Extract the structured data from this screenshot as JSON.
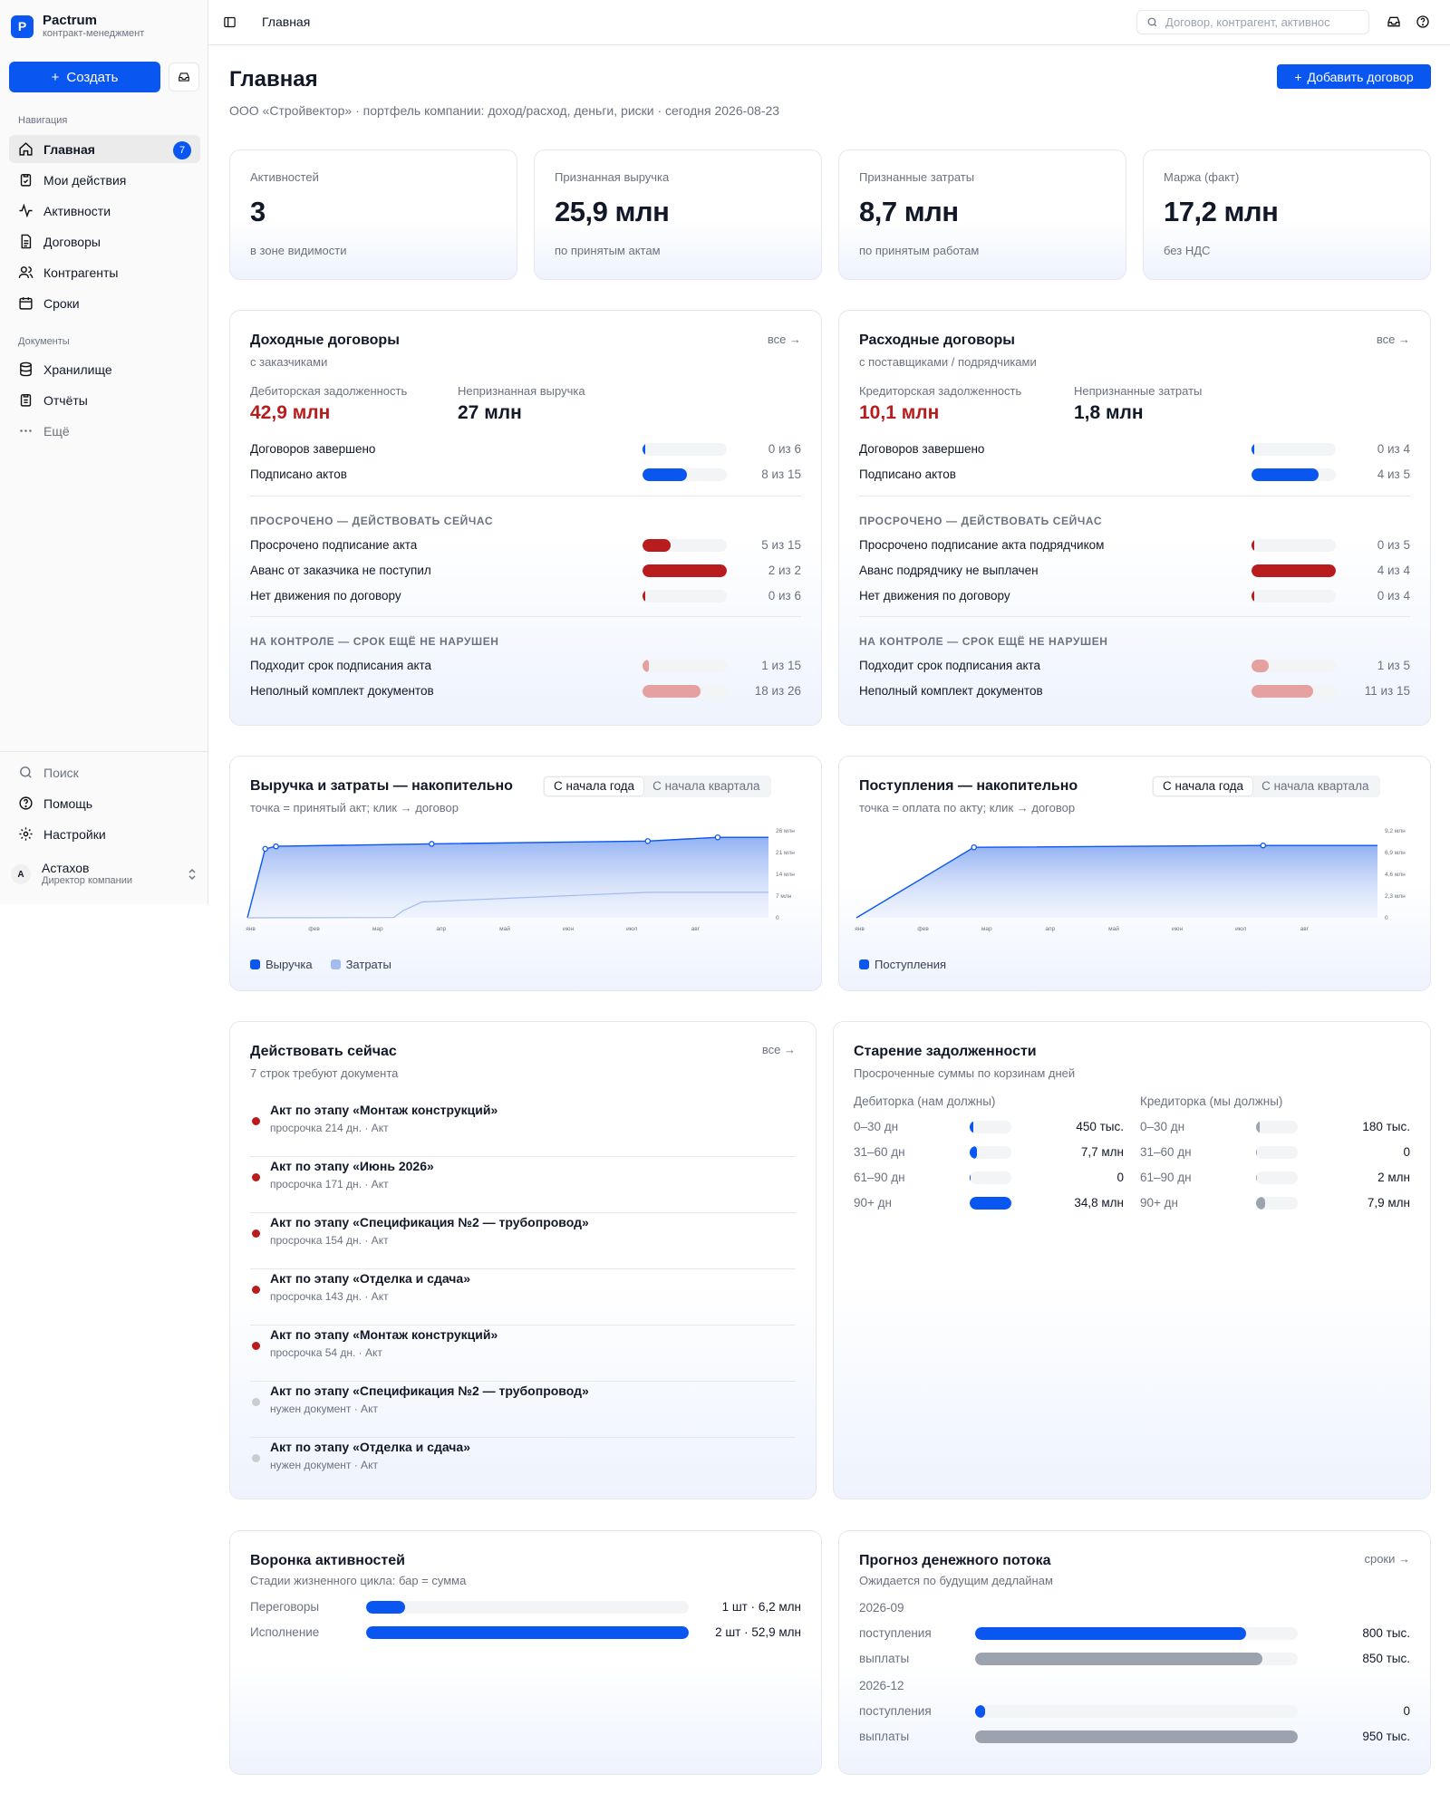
{
  "app": {
    "name": "Pactrum",
    "subtitle": "контракт-менеджмент",
    "logo_letter": "P"
  },
  "sidebar": {
    "create_label": "Создать",
    "nav_heading": "Навигация",
    "nav": [
      {
        "label": "Главная",
        "icon": "home-icon",
        "badge": "7",
        "active": true
      },
      {
        "label": "Мои действия",
        "icon": "clipboard-check-icon"
      },
      {
        "label": "Активности",
        "icon": "activity-icon"
      },
      {
        "label": "Договоры",
        "icon": "document-icon"
      },
      {
        "label": "Контрагенты",
        "icon": "users-icon"
      },
      {
        "label": "Сроки",
        "icon": "calendar-icon"
      }
    ],
    "docs_heading": "Документы",
    "docs": [
      {
        "label": "Хранилище",
        "icon": "database-icon"
      },
      {
        "label": "Отчёты",
        "icon": "report-icon"
      },
      {
        "label": "Ещё",
        "icon": "more-icon"
      }
    ],
    "footer": [
      {
        "label": "Поиск",
        "icon": "search-icon"
      },
      {
        "label": "Помощь",
        "icon": "help-icon"
      },
      {
        "label": "Настройки",
        "icon": "settings-icon"
      }
    ],
    "user": {
      "initial": "A",
      "name": "Астахов",
      "role": "Директор компании"
    }
  },
  "topbar": {
    "breadcrumb": "Главная",
    "search_placeholder": "Договор, контрагент, активнос"
  },
  "header": {
    "title": "Главная",
    "subtitle": "ООО «Стройвектор» · портфель компании: доход/расход, деньги, риски · сегодня 2026-08-23",
    "add_button": "Добавить договор"
  },
  "kpis": [
    {
      "label": "Активностей",
      "value": "3",
      "note": "в зоне видимости"
    },
    {
      "label": "Признанная выручка",
      "value": "25,9 млн",
      "note": "по принятым актам"
    },
    {
      "label": "Признанные затраты",
      "value": "8,7 млн",
      "note": "по принятым работам"
    },
    {
      "label": "Маржа (факт)",
      "value": "17,2 млн",
      "note": "без НДС"
    }
  ],
  "income": {
    "title": "Доходные договоры",
    "subtitle": "с заказчиками",
    "link": "все →",
    "m1_label": "Дебиторская задолженность",
    "m1_value": "42,9 млн",
    "m2_label": "Непризнанная выручка",
    "m2_value": "27 млн",
    "rows": [
      {
        "label": "Договоров завершено",
        "count": "0 из 6",
        "fraction": 0.0,
        "color": "#0a56f0"
      },
      {
        "label": "Подписано актов",
        "count": "8 из 15",
        "fraction": 0.53,
        "color": "#0a56f0"
      }
    ],
    "overdue_heading": "ПРОСРОЧЕНО — ДЕЙСТВОВАТЬ СЕЙЧАС",
    "overdue": [
      {
        "label": "Просрочено подписание акта",
        "count": "5 из 15",
        "fraction": 0.33,
        "color": "#b91c1c"
      },
      {
        "label": "Аванс от заказчика не поступил",
        "count": "2 из 2",
        "fraction": 1.0,
        "color": "#b91c1c"
      },
      {
        "label": "Нет движения по договору",
        "count": "0 из 6",
        "fraction": 0.0,
        "color": "#b91c1c"
      }
    ],
    "control_heading": "НА КОНТРОЛЕ — СРОК ЕЩЁ НЕ НАРУШЕН",
    "control": [
      {
        "label": "Подходит срок подписания акта",
        "count": "1 из 15",
        "fraction": 0.07,
        "color": "#e5a0a0"
      },
      {
        "label": "Неполный комплект документов",
        "count": "18 из 26",
        "fraction": 0.69,
        "color": "#e5a0a0"
      }
    ]
  },
  "expense": {
    "title": "Расходные договоры",
    "subtitle": "с поставщиками / подрядчиками",
    "link": "все →",
    "m1_label": "Кредиторская задолженность",
    "m1_value": "10,1 млн",
    "m2_label": "Непризнанные затраты",
    "m2_value": "1,8 млн",
    "rows": [
      {
        "label": "Договоров завершено",
        "count": "0 из 4",
        "fraction": 0.0,
        "color": "#0a56f0"
      },
      {
        "label": "Подписано актов",
        "count": "4 из 5",
        "fraction": 0.8,
        "color": "#0a56f0"
      }
    ],
    "overdue_heading": "ПРОСРОЧЕНО — ДЕЙСТВОВАТЬ СЕЙЧАС",
    "overdue": [
      {
        "label": "Просрочено подписание акта подрядчиком",
        "count": "0 из 5",
        "fraction": 0.0,
        "color": "#b91c1c"
      },
      {
        "label": "Аванс подрядчику не выплачен",
        "count": "4 из 4",
        "fraction": 1.0,
        "color": "#b91c1c"
      },
      {
        "label": "Нет движения по договору",
        "count": "0 из 4",
        "fraction": 0.0,
        "color": "#b91c1c"
      }
    ],
    "control_heading": "НА КОНТРОЛЕ — СРОК ЕЩЁ НЕ НАРУШЕН",
    "control": [
      {
        "label": "Подходит срок подписания акта",
        "count": "1 из 5",
        "fraction": 0.2,
        "color": "#e5a0a0"
      },
      {
        "label": "Неполный комплект документов",
        "count": "11 из 15",
        "fraction": 0.73,
        "color": "#e5a0a0"
      }
    ]
  },
  "rev_chart": {
    "title": "Выручка и затраты — накопительно",
    "subtitle": "точка = принятый акт; клик → договор",
    "tabs": [
      "С начала года",
      "С начала квартала"
    ],
    "active_tab": 0
  },
  "pay_chart": {
    "title": "Поступления — накопительно",
    "subtitle": "точка = оплата по акту; клик → договор",
    "tabs": [
      "С начала года",
      "С начала квартала"
    ],
    "active_tab": 0
  },
  "chart_data": [
    {
      "type": "area",
      "title": "Выручка и затраты — накопительно",
      "x_ticks": [
        "янв",
        "фев",
        "мар",
        "апр",
        "май",
        "июн",
        "июл",
        "авг"
      ],
      "y_ticks": [
        "26 млн",
        "21 млн",
        "14 млн",
        "7 млн",
        "0"
      ],
      "ylim": [
        0,
        28
      ],
      "x_domain": [
        0,
        8.2
      ],
      "series": [
        {
          "name": "Выручка",
          "color": "#0a56f0",
          "fill": true,
          "points": [
            [
              0,
              0
            ],
            [
              0.28,
              22.2
            ],
            [
              0.45,
              23.0
            ],
            [
              2.9,
              23.8
            ],
            [
              6.3,
              24.7
            ],
            [
              7.4,
              25.9
            ],
            [
              8.2,
              25.9
            ]
          ]
        },
        {
          "name": "Затраты",
          "color": "#a5bbee",
          "fill": false,
          "points": [
            [
              0,
              0
            ],
            [
              2.3,
              0.1
            ],
            [
              2.45,
              2.3
            ],
            [
              2.75,
              5.1
            ],
            [
              6.3,
              8.2
            ],
            [
              8.2,
              8.2
            ]
          ]
        }
      ],
      "dots": [
        [
          0.28,
          22.2
        ],
        [
          0.45,
          23.0
        ],
        [
          2.9,
          23.8
        ],
        [
          6.3,
          24.7
        ],
        [
          7.4,
          25.9
        ]
      ],
      "grid": false,
      "legend": "bottom-left"
    },
    {
      "type": "area",
      "title": "Поступления — накопительно",
      "x_ticks": [
        "янв",
        "фев",
        "мар",
        "апр",
        "май",
        "июн",
        "июл",
        "авг"
      ],
      "y_ticks": [
        "9,2 млн",
        "6,9 млн",
        "4,6 млн",
        "2,3 млн",
        "0"
      ],
      "ylim": [
        0,
        9.5
      ],
      "x_domain": [
        0,
        8.2
      ],
      "series": [
        {
          "name": "Поступления",
          "color": "#0a56f0",
          "fill": true,
          "points": [
            [
              0,
              0
            ],
            [
              1.85,
              7.7
            ],
            [
              6.4,
              7.9
            ],
            [
              8.2,
              7.9
            ]
          ]
        }
      ],
      "dots": [
        [
          1.85,
          7.7
        ],
        [
          6.4,
          7.9
        ]
      ],
      "grid": false,
      "legend": "bottom-left"
    }
  ],
  "actions": {
    "title": "Действовать сейчас",
    "subtitle": "7 строк требуют документа",
    "link": "все →",
    "items": [
      {
        "title": "Акт по этапу «Монтаж конструкций»",
        "meta": "просрочка 214 дн. · Акт",
        "dot": "#b91c1c"
      },
      {
        "title": "Акт по этапу «Июнь 2026»",
        "meta": "просрочка 171 дн. · Акт",
        "dot": "#b91c1c"
      },
      {
        "title": "Акт по этапу «Спецификация №2 — трубопровод»",
        "meta": "просрочка 154 дн. · Акт",
        "dot": "#b91c1c"
      },
      {
        "title": "Акт по этапу «Отделка и сдача»",
        "meta": "просрочка 143 дн. · Акт",
        "dot": "#b91c1c"
      },
      {
        "title": "Акт по этапу «Монтаж конструкций»",
        "meta": "просрочка 54 дн. · Акт",
        "dot": "#b91c1c"
      },
      {
        "title": "Акт по этапу «Спецификация №2 — трубопровод»",
        "meta": "нужен документ · Акт",
        "dot": "#c9ccd2"
      },
      {
        "title": "Акт по этапу «Отделка и сдача»",
        "meta": "нужен документ · Акт",
        "dot": "#c9ccd2"
      }
    ]
  },
  "aging": {
    "title": "Старение задолженности",
    "subtitle": "Просроченные суммы по корзинам дней",
    "receivable_title": "Дебиторка (нам должны)",
    "payable_title": "Кредиторка (мы должны)",
    "receivable": [
      {
        "bucket": "0–30 дн",
        "value": "450 тыс.",
        "fraction": 0.02
      },
      {
        "bucket": "31–60 дн",
        "value": "7,7 млн",
        "fraction": 0.18
      },
      {
        "bucket": "61–90 дн",
        "value": "0",
        "fraction": 0.0
      },
      {
        "bucket": "90+ дн",
        "value": "34,8 млн",
        "fraction": 1.0
      }
    ],
    "payable": [
      {
        "bucket": "0–30 дн",
        "value": "180 тыс.",
        "fraction": 0.02
      },
      {
        "bucket": "31–60 дн",
        "value": "0",
        "fraction": 0.0
      },
      {
        "bucket": "61–90 дн",
        "value": "2 млн",
        "fraction": 0.0
      },
      {
        "bucket": "90+ дн",
        "value": "7,9 млн",
        "fraction": 0.22
      }
    ],
    "receivable_color": "#0a56f0",
    "payable_color": "#9ca3af"
  },
  "funnel": {
    "title": "Воронка активностей",
    "subtitle": "Стадии жизненного цикла: бар = сумма",
    "rows": [
      {
        "label": "Переговоры",
        "value": "1 шт · 6,2 млн",
        "fraction": 0.12
      },
      {
        "label": "Исполнение",
        "value": "2 шт · 52,9 млн",
        "fraction": 1.0
      }
    ]
  },
  "forecast": {
    "title": "Прогноз денежного потока",
    "subtitle": "Ожидается по будущим дедлайнам",
    "link": "сроки →",
    "periods": [
      {
        "period": "2026-09",
        "rows": [
          {
            "label": "поступления",
            "value": "800 тыс.",
            "fraction": 0.84,
            "color": "#0a56f0"
          },
          {
            "label": "выплаты",
            "value": "850 тыс.",
            "fraction": 0.89,
            "color": "#9ca3af"
          }
        ]
      },
      {
        "period": "2026-12",
        "rows": [
          {
            "label": "поступления",
            "value": "0",
            "fraction": 0.0,
            "color": "#0a56f0"
          },
          {
            "label": "выплаты",
            "value": "950 тыс.",
            "fraction": 1.0,
            "color": "#9ca3af"
          }
        ]
      }
    ]
  }
}
